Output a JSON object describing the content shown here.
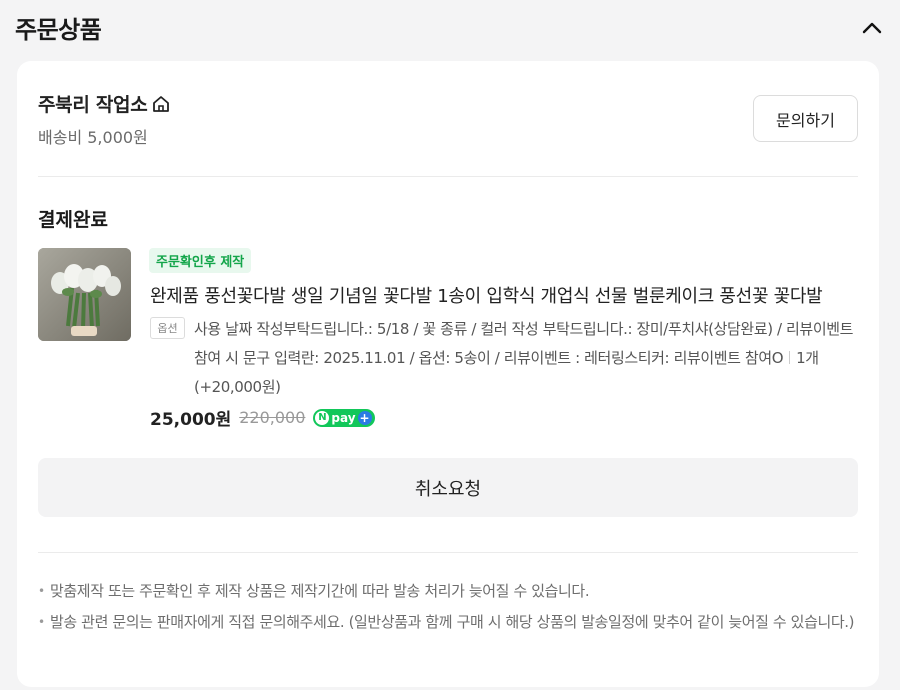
{
  "section": {
    "title": "주문상품",
    "collapse_icon": "chevron-up-icon"
  },
  "seller": {
    "name": "주북리 작업소",
    "store_icon": "home-icon",
    "shipping": "배송비 5,000원",
    "inquiry_label": "문의하기"
  },
  "order": {
    "status": "결제완료",
    "product": {
      "badge": "주문확인후 제작",
      "title": "완제품 풍선꽃다발 생일 기념일 꽃다발 1송이 입학식 개업식 선물 벌룬케이크 풍선꽃 꽃다발",
      "option_label": "옵션",
      "option_text": "사용 날짜 작성부탁드립니다.: 5/18 / 꽃 종류 / 컬러 작성 부탁드립니다.: 장미/푸치샤(상담완료) / 리뷰이벤트 참여 시 문구 입력란: 2025.11.01 / 옵션: 5송이 / 리뷰이벤트 : 레터링스티커: 리뷰이벤트 참여O",
      "quantity": "1개 (+20,000원)",
      "price": "25,000원",
      "original_price": "220,000",
      "npay": {
        "n": "N",
        "pay": "pay",
        "plus": "+"
      }
    },
    "cancel_label": "취소요청"
  },
  "notices": [
    "맞춤제작 또는 주문확인 후 제작 상품은 제작기간에 따라 발송 처리가 늦어질 수 있습니다.",
    "발송 관련 문의는 판매자에게 직접 문의해주세요. (일반상품과 함께 구매 시 해당 상품의 발송일정에 맞추어 같이 늦어질 수 있습니다.)"
  ],
  "colors": {
    "badge_green": "#13a54a",
    "npay_green": "#12c75a",
    "npay_blue": "#2a7be4"
  }
}
